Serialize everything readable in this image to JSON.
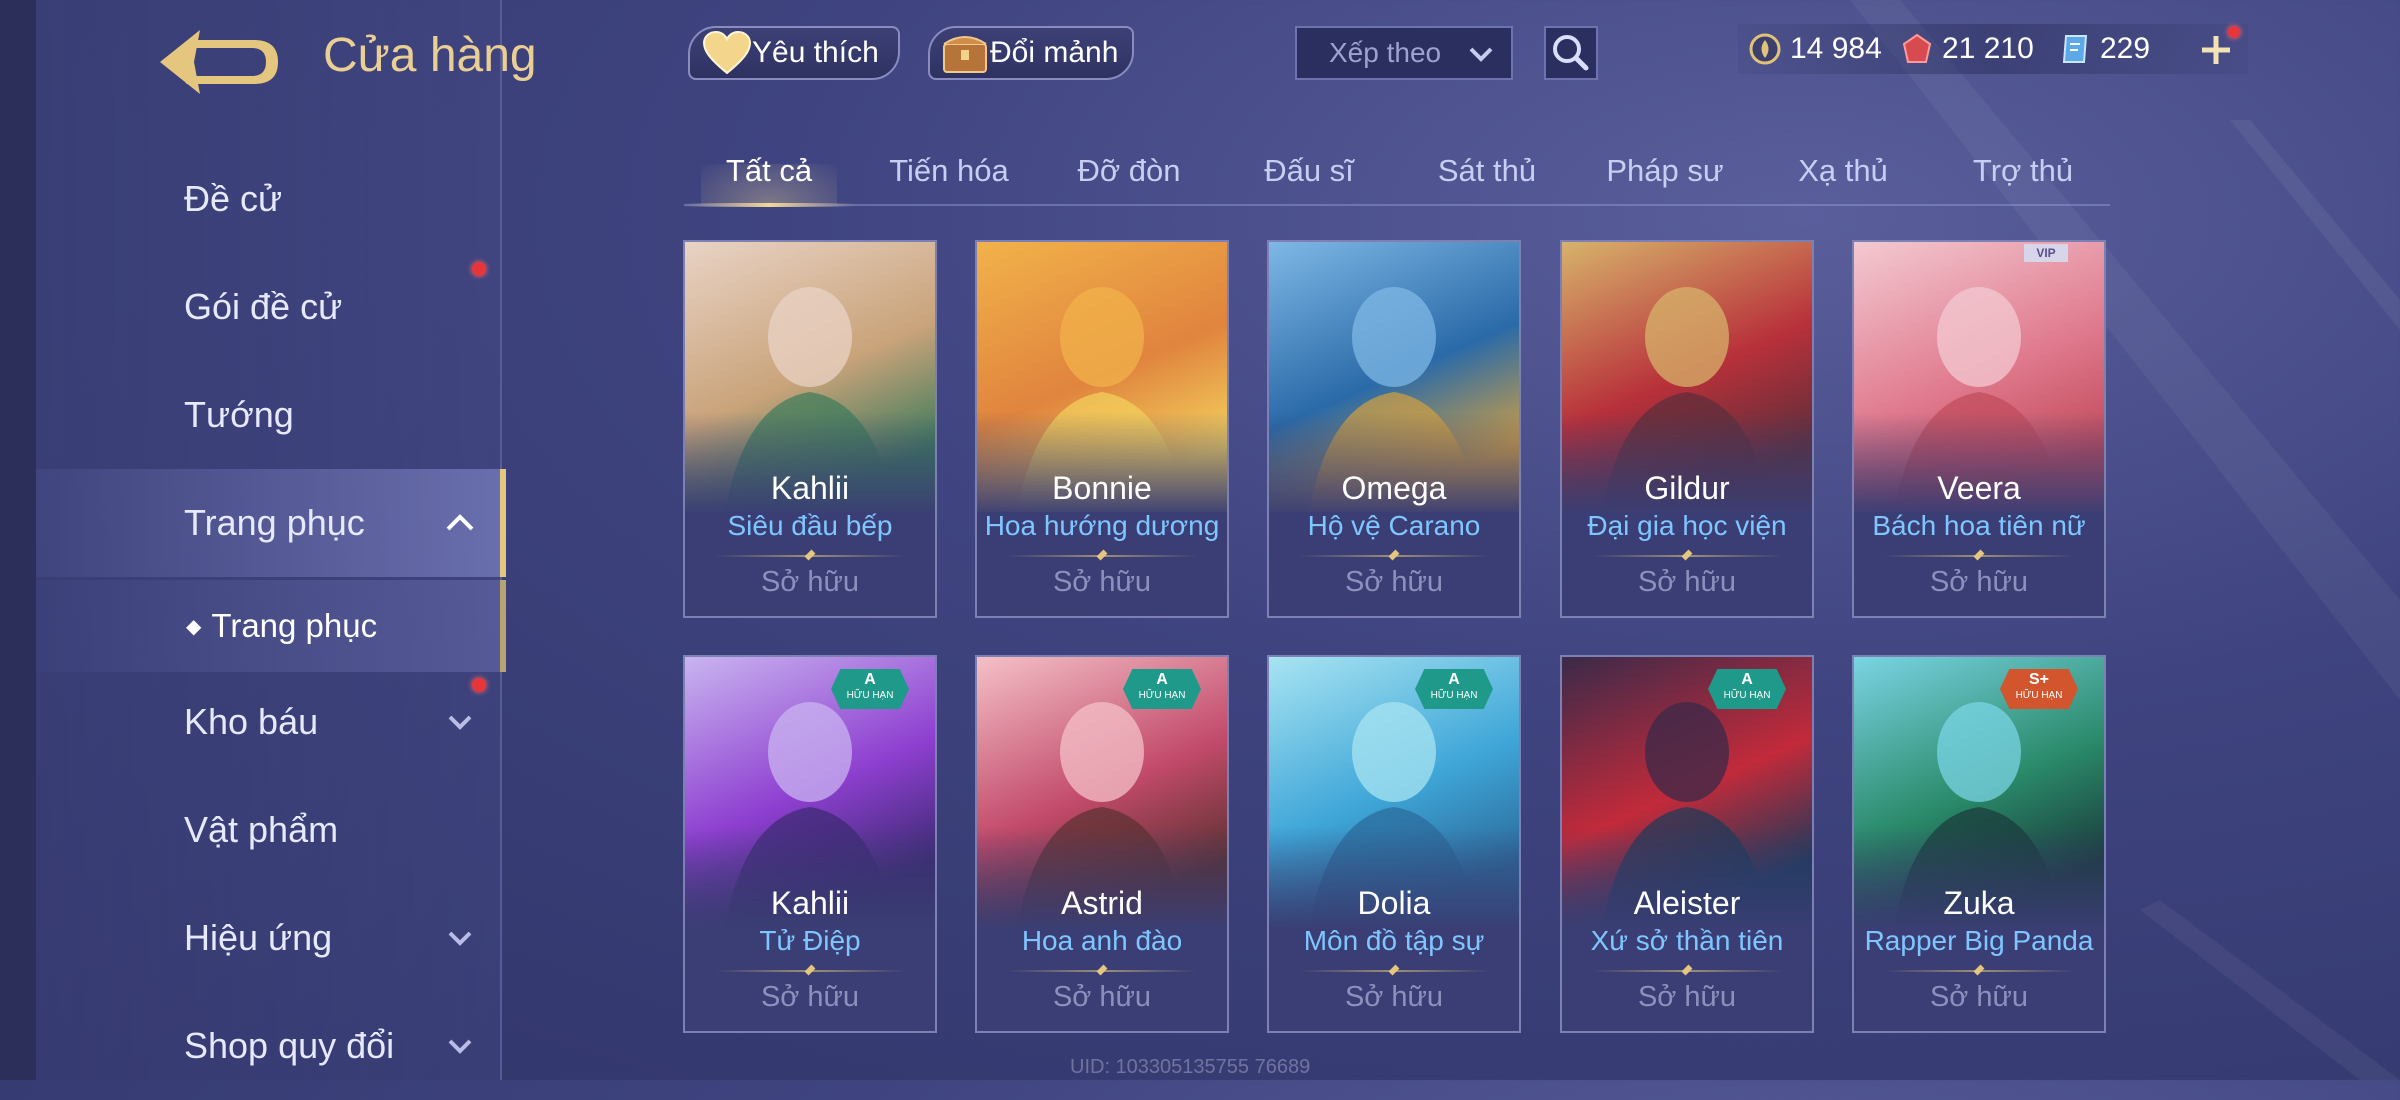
{
  "header": {
    "title": "Cửa hàng",
    "favorite_label": "Yêu thích",
    "exchange_label": "Đổi mảnh",
    "sort_placeholder": "Xếp theo"
  },
  "currencies": [
    {
      "name": "gold-coin",
      "value": "14 984",
      "color": "#e0c27a"
    },
    {
      "name": "ruby",
      "value": "21 210",
      "color": "#e25a5a"
    },
    {
      "name": "voucher",
      "value": "229",
      "color": "#8fc8ff"
    }
  ],
  "sidebar": {
    "items": [
      {
        "label": "Đề cử"
      },
      {
        "label": "Gói đề cử"
      },
      {
        "label": "Tướng"
      },
      {
        "label": "Trang phục"
      },
      {
        "label": "Kho báu"
      },
      {
        "label": "Vật phẩm"
      },
      {
        "label": "Hiệu ứng"
      },
      {
        "label": "Shop quy đổi"
      }
    ],
    "sub_item": {
      "label": "Trang phục"
    }
  },
  "tabs": [
    "Tất cả",
    "Tiến hóa",
    "Đỡ đòn",
    "Đấu sĩ",
    "Sát thủ",
    "Pháp sư",
    "Xạ thủ",
    "Trợ thủ"
  ],
  "skins": [
    {
      "hero": "Kahlii",
      "skin": "Siêu đầu bếp",
      "status": "Sở hữu",
      "colors": [
        "#e9d3c5",
        "#c9a37a",
        "#3b7a5a"
      ]
    },
    {
      "hero": "Bonnie",
      "skin": "Hoa hướng dương",
      "status": "Sở hữu",
      "colors": [
        "#f2b24a",
        "#e0843e",
        "#f4d35e"
      ]
    },
    {
      "hero": "Omega",
      "skin": "Hộ vệ Carano",
      "status": "Sở hữu",
      "colors": [
        "#7fb8e6",
        "#2a6aa8",
        "#d4a140"
      ]
    },
    {
      "hero": "Gildur",
      "skin": "Đại gia học viện",
      "status": "Sở hữu",
      "colors": [
        "#d7b36b",
        "#b8303a",
        "#5a2e3a"
      ]
    },
    {
      "hero": "Veera",
      "skin": "Bách hoa tiên nữ",
      "status": "Sở hữu",
      "colors": [
        "#f3c9d1",
        "#e07a8e",
        "#c04a5a"
      ],
      "vip": "VIP"
    },
    {
      "hero": "Kahlii",
      "skin": "Tử Điệp",
      "status": "Sở hữu",
      "colors": [
        "#c9b4f0",
        "#8e3fd0",
        "#3a2a70"
      ],
      "tag": {
        "rank": "A",
        "label": "HỮU HẠN",
        "color": "#1f9a8a"
      }
    },
    {
      "hero": "Astrid",
      "skin": "Hoa anh đào",
      "status": "Sở hữu",
      "colors": [
        "#f4c0c8",
        "#c24a6a",
        "#5a3030"
      ],
      "tag": {
        "rank": "A",
        "label": "HỮU HẠN",
        "color": "#1f9a8a"
      }
    },
    {
      "hero": "Dolia",
      "skin": "Môn đồ tập sự",
      "status": "Sở hữu",
      "colors": [
        "#a8e4f2",
        "#3fa6d8",
        "#2a6a9a"
      ],
      "tag": {
        "rank": "A",
        "label": "HỮU HẠN",
        "color": "#1f9a8a"
      }
    },
    {
      "hero": "Aleister",
      "skin": "Xứ sở thần tiên",
      "status": "Sở hữu",
      "colors": [
        "#3a2a4a",
        "#c22a3a",
        "#1a3a5a"
      ],
      "tag": {
        "rank": "A",
        "label": "HỮU HẠN",
        "color": "#1f9a8a"
      }
    },
    {
      "hero": "Zuka",
      "skin": "Rapper Big Panda",
      "status": "Sở hữu",
      "colors": [
        "#7ad4e4",
        "#2a8a6a",
        "#1a3a3a"
      ],
      "tag": {
        "rank": "S+",
        "label": "HỮU HẠN",
        "color": "#d2552e"
      }
    }
  ],
  "footer": {
    "uid": "UID: 103305135755 76689"
  }
}
